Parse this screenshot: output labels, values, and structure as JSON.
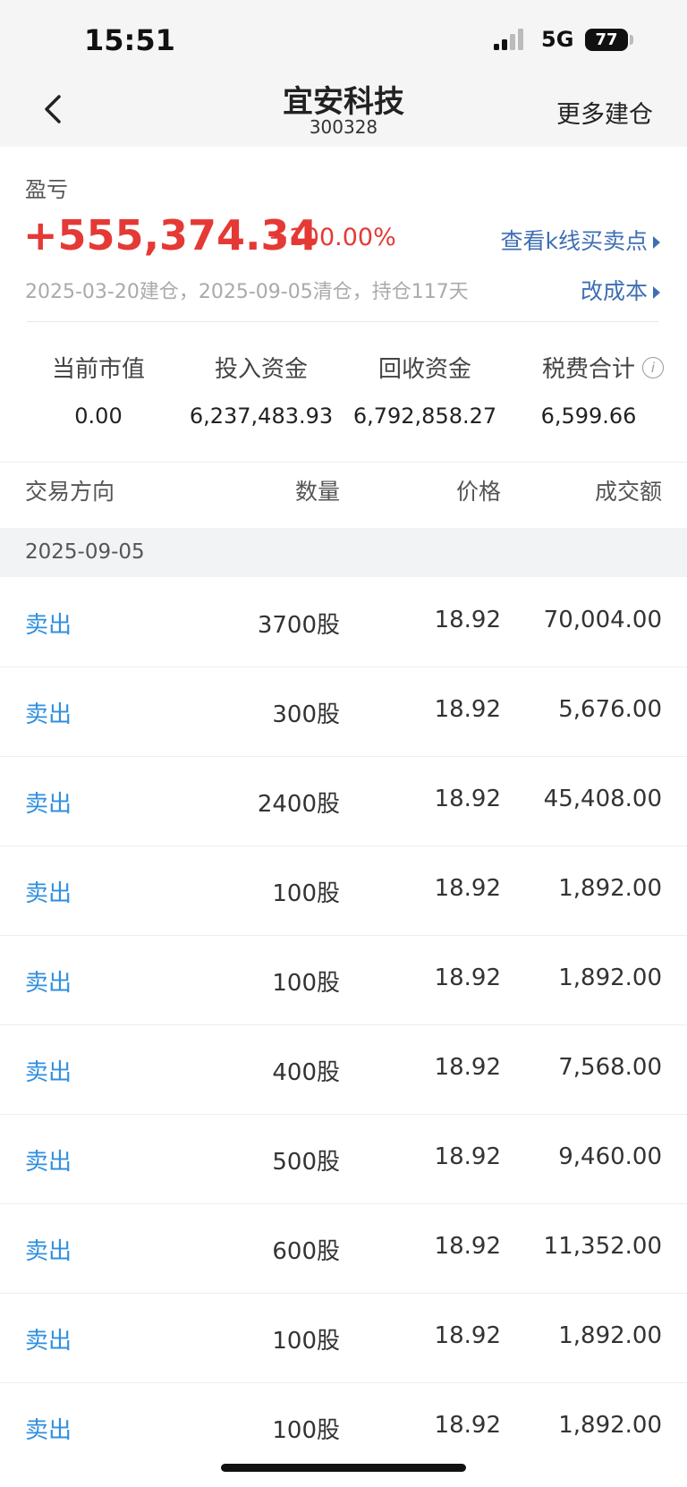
{
  "status": {
    "time": "15:51",
    "network": "5G",
    "battery": "77"
  },
  "nav": {
    "title": "宜安科技",
    "code": "300328",
    "action": "更多建仓"
  },
  "summary": {
    "label": "盈亏",
    "profit": "+555,374.34",
    "percent": "+100.00%",
    "kline_link": "查看k线买卖点",
    "dates": "2025-03-20建仓，2025-09-05清仓，持仓117天",
    "cost_link": "改成本"
  },
  "stats": [
    {
      "label": "当前市值",
      "value": "0.00"
    },
    {
      "label": "投入资金",
      "value": "6,237,483.93"
    },
    {
      "label": "回收资金",
      "value": "6,792,858.27"
    },
    {
      "label": "税费合计",
      "value": "6,599.66"
    }
  ],
  "columns": {
    "direction": "交易方向",
    "quantity": "数量",
    "price": "价格",
    "amount": "成交额"
  },
  "date_group": "2025-09-05",
  "trades": [
    {
      "direction": "卖出",
      "quantity": "3700股",
      "price": "18.92",
      "amount": "70,004.00"
    },
    {
      "direction": "卖出",
      "quantity": "300股",
      "price": "18.92",
      "amount": "5,676.00"
    },
    {
      "direction": "卖出",
      "quantity": "2400股",
      "price": "18.92",
      "amount": "45,408.00"
    },
    {
      "direction": "卖出",
      "quantity": "100股",
      "price": "18.92",
      "amount": "1,892.00"
    },
    {
      "direction": "卖出",
      "quantity": "100股",
      "price": "18.92",
      "amount": "1,892.00"
    },
    {
      "direction": "卖出",
      "quantity": "400股",
      "price": "18.92",
      "amount": "7,568.00"
    },
    {
      "direction": "卖出",
      "quantity": "500股",
      "price": "18.92",
      "amount": "9,460.00"
    },
    {
      "direction": "卖出",
      "quantity": "600股",
      "price": "18.92",
      "amount": "11,352.00"
    },
    {
      "direction": "卖出",
      "quantity": "100股",
      "price": "18.92",
      "amount": "1,892.00"
    },
    {
      "direction": "卖出",
      "quantity": "100股",
      "price": "18.92",
      "amount": "1,892.00"
    }
  ],
  "colors": {
    "profit_red": "#e53935",
    "link_blue": "#3f6fb3",
    "sell_blue": "#2f8fe0"
  },
  "icons": {
    "back": "chevron-left-icon",
    "info": "info-icon",
    "link_arrow": "triangle-right-icon"
  }
}
